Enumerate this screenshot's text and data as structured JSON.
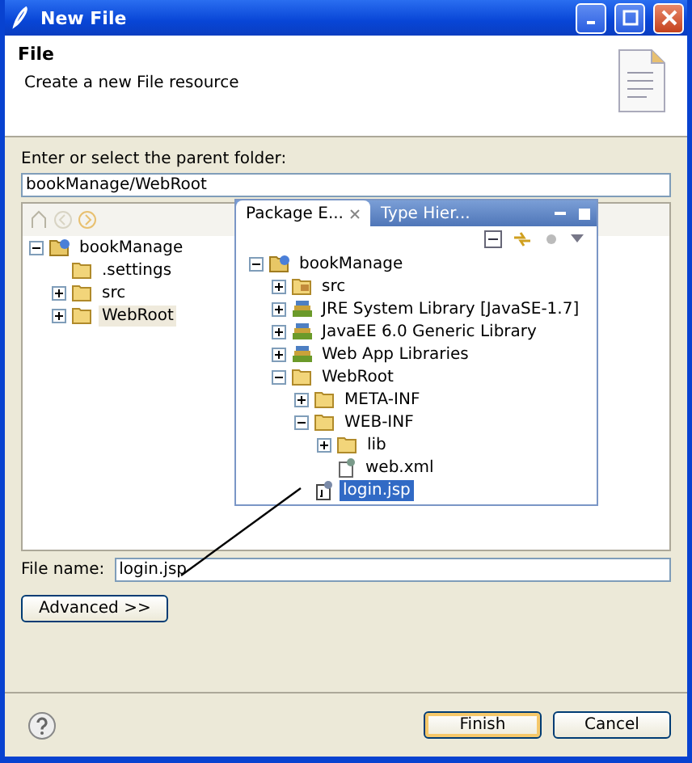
{
  "window": {
    "title": "New File"
  },
  "header": {
    "title": "File",
    "description": "Create a new File resource"
  },
  "parent_folder": {
    "label": "Enter or select the parent folder:",
    "value": "bookManage/WebRoot"
  },
  "folder_tree": {
    "items": [
      {
        "label": "bookManage",
        "kind": "project",
        "expanded": true,
        "selected": false,
        "children": [
          {
            "label": ".settings",
            "kind": "folder",
            "selected": false
          },
          {
            "label": "src",
            "kind": "folder",
            "expanded": false,
            "selected": false
          },
          {
            "label": "WebRoot",
            "kind": "folder",
            "expanded": false,
            "selected": true
          }
        ]
      }
    ]
  },
  "package_explorer": {
    "tabs": [
      {
        "label": "Package E...",
        "selected": true
      },
      {
        "label": "Type Hier...",
        "selected": false
      }
    ],
    "items": [
      {
        "label": "bookManage",
        "kind": "project",
        "expanded": true,
        "selected": false,
        "children": [
          {
            "label": "src",
            "kind": "source",
            "expanded": false,
            "selected": false
          },
          {
            "label": "JRE System Library [JavaSE-1.7]",
            "kind": "library",
            "expanded": false,
            "selected": false
          },
          {
            "label": "JavaEE 6.0 Generic Library",
            "kind": "library",
            "expanded": false,
            "selected": false
          },
          {
            "label": "Web App Libraries",
            "kind": "library",
            "expanded": false,
            "selected": false
          },
          {
            "label": "WebRoot",
            "kind": "folder",
            "expanded": true,
            "selected": false,
            "children": [
              {
                "label": "META-INF",
                "kind": "folder",
                "expanded": false,
                "selected": false
              },
              {
                "label": "WEB-INF",
                "kind": "folder",
                "expanded": true,
                "selected": false,
                "children": [
                  {
                    "label": "lib",
                    "kind": "folder",
                    "expanded": false,
                    "selected": false
                  },
                  {
                    "label": "web.xml",
                    "kind": "xml",
                    "selected": false
                  }
                ]
              },
              {
                "label": "login.jsp",
                "kind": "jsp",
                "selected": true
              }
            ]
          }
        ]
      }
    ]
  },
  "file_name": {
    "label": "File name:",
    "value": "login.jsp"
  },
  "advanced_button": "Advanced >>",
  "buttons": [
    "Finish",
    "Cancel"
  ]
}
